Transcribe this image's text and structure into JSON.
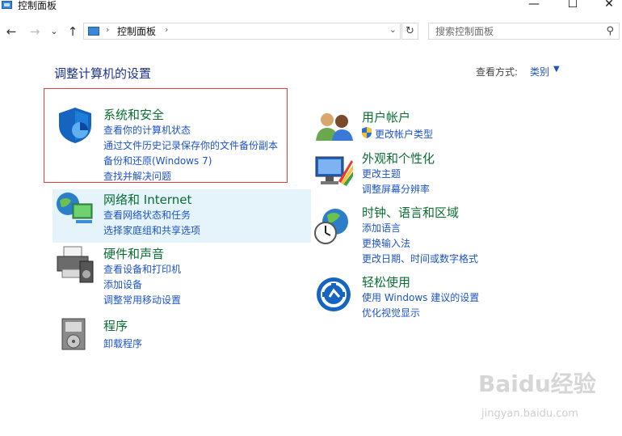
{
  "window": {
    "title": "控制面板",
    "minimize": "—",
    "maximize": "☐",
    "close": "✕"
  },
  "nav": {
    "back": "←",
    "forward": "→",
    "recent": "⌄",
    "up": "↑"
  },
  "address": {
    "crumb": "控制面板",
    "sep1": "›",
    "sep2": "›",
    "drop": "⌄"
  },
  "refresh": "↻",
  "search": {
    "placeholder": "搜索控制面板",
    "icon": "⚲"
  },
  "header": {
    "title": "调整计算机的设置",
    "view_label": "查看方式:",
    "view_value": "类别",
    "view_caret": "▼"
  },
  "categories": {
    "system": {
      "title": "系统和安全",
      "links": [
        "查看你的计算机状态",
        "通过文件历史记录保存你的文件备份副本",
        "备份和还原(Windows 7)",
        "查找并解决问题"
      ]
    },
    "network": {
      "title": "网络和 Internet",
      "links": [
        "查看网络状态和任务",
        "选择家庭组和共享选项"
      ]
    },
    "hardware": {
      "title": "硬件和声音",
      "links": [
        "查看设备和打印机",
        "添加设备",
        "调整常用移动设置"
      ]
    },
    "programs": {
      "title": "程序",
      "links": [
        "卸载程序"
      ]
    },
    "users": {
      "title": "用户帐户",
      "links": [
        "更改帐户类型"
      ]
    },
    "appearance": {
      "title": "外观和个性化",
      "links": [
        "更改主题",
        "调整屏幕分辨率"
      ]
    },
    "clock": {
      "title": "时钟、语言和区域",
      "links": [
        "添加语言",
        "更换输入法",
        "更改日期、时间或数字格式"
      ]
    },
    "ease": {
      "title": "轻松使用",
      "links": [
        "使用 Windows 建议的设置",
        "优化视觉显示"
      ]
    }
  },
  "watermark": {
    "logo": "Baidu经验",
    "url": "jingyan.baidu.com"
  }
}
